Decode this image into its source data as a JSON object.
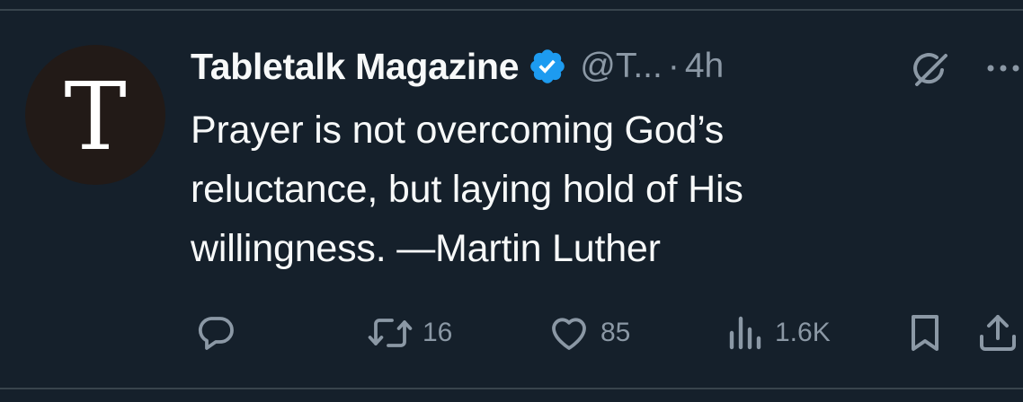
{
  "author": {
    "avatar_letter": "T",
    "display_name": "Tabletalk Magazine",
    "handle": "@T...",
    "separator": "·",
    "time": "4h"
  },
  "tweet": {
    "text_lines": [
      "Prayer is not overcoming God’s",
      "reluctance, but laying hold of His",
      "willingness. —Martin Luther"
    ]
  },
  "actions": {
    "reply_count": "",
    "retweet_count": "16",
    "like_count": "85",
    "views_count": "1.6K"
  },
  "icons": {
    "verified": "verified-badge-icon",
    "grok": "grok-icon",
    "more": "more-icon",
    "reply": "reply-icon",
    "retweet": "retweet-icon",
    "like": "heart-icon",
    "views": "views-icon",
    "bookmark": "bookmark-icon",
    "share": "share-icon"
  },
  "colors": {
    "background": "#15202b",
    "text": "#f7f9f9",
    "secondary": "#8b98a5",
    "verified_blue": "#1d9bf0"
  }
}
